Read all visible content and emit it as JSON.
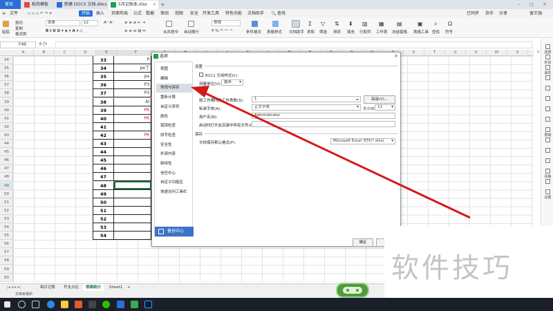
{
  "tabs": {
    "home": "首页",
    "wps": "稻壳模板",
    "docx": "新建 DOCX 文档.docx",
    "xlsx": "5月记账本.xlsx"
  },
  "menu": {
    "file": "文件",
    "start": "开始",
    "insert": "插入",
    "page_layout": "页面布局",
    "formula": "公式",
    "data": "数据",
    "review": "审阅",
    "view": "视图",
    "security": "安全",
    "dev_tools": "开发工具",
    "special": "特色功能",
    "doc_helper": "文档助手",
    "search": "查找",
    "sync": "已同步",
    "collab": "协作",
    "share": "分享",
    "user": "留王强"
  },
  "ribbon": {
    "paste": "粘贴",
    "cut": "剪切",
    "copy": "复制",
    "format_painter": "格式刷",
    "font": "宋体",
    "font_size": "12",
    "merge": "合并居中",
    "wrap": "自动换行",
    "number_format": "常规",
    "cond_format": "条件格式",
    "table_style": "表格样式",
    "doc_helper": "文档助手",
    "sum": "求和",
    "filter": "筛选",
    "sort": "排序",
    "fill": "填充",
    "row_col": "行和列",
    "worksheet": "工作表",
    "freeze": "冻结窗格",
    "table_tools": "表格工具",
    "find": "查找",
    "symbol": "符号"
  },
  "formula_bar": {
    "cell_ref": "F49"
  },
  "columns": [
    "A",
    "B",
    "C",
    "D",
    "E",
    "F",
    "G",
    "H",
    "I",
    "J",
    "K",
    "L",
    "M",
    "N",
    "O",
    "P",
    "Q",
    "R",
    "S",
    "T",
    "U",
    "V",
    "W",
    "X",
    "Y",
    "Z"
  ],
  "row_numbers": [
    "34",
    "35",
    "36",
    "37",
    "38",
    "39",
    "40",
    "41",
    "42",
    "43",
    "44",
    "45",
    "46",
    "47",
    "48",
    "49",
    "50",
    "51",
    "52",
    "53",
    "54",
    "55",
    "56",
    "57",
    "58",
    "59",
    "60",
    "61"
  ],
  "column_e_values": [
    "33",
    "34",
    "35",
    "36",
    "37",
    "38",
    "39",
    "40",
    "41",
    "42",
    "43",
    "44",
    "45",
    "46",
    "47",
    "48",
    "49",
    "50",
    "51",
    "52",
    "53",
    "54"
  ],
  "column_f_values": [
    "P",
    "pe丁",
    "pa",
    "P3",
    "P3",
    "AI",
    "PR",
    "PR",
    "",
    "PR",
    "",
    "",
    "",
    "",
    "",
    "",
    "",
    "",
    "",
    "",
    "",
    ""
  ],
  "column_f_red": [
    false,
    false,
    false,
    false,
    false,
    false,
    true,
    true,
    false,
    true,
    false,
    false,
    false,
    false,
    false,
    false,
    false,
    false,
    false,
    false,
    false,
    false
  ],
  "sheet_tabs": [
    "每日记账",
    "开支占比",
    "视频统计",
    "Sheet1"
  ],
  "active_sheet_index": 2,
  "status": "文档未保护",
  "right_panel": [
    "选择",
    "形状",
    "属性",
    "",
    "",
    "",
    "",
    "",
    "限制",
    "",
    "",
    "",
    "风格",
    "",
    "设置"
  ],
  "dialog": {
    "title": "选项",
    "nav_items": [
      "视图",
      "编辑",
      "常规与保存",
      "重新计算",
      "自定义序列",
      "颜色",
      "错误检查",
      "拼写检查",
      "安全性",
      "外部内容",
      "新特性",
      "信任中心",
      "自定义功能区",
      "快速访问工具栏"
    ],
    "selected_nav_index": 2,
    "backup_center": "备份中心",
    "section_settings": "设置",
    "r1c1_label": "R1C1 引用样式(C)",
    "unit_label": "测量单位(U):",
    "unit_value": "厘米",
    "new_sheets_label": "新工作簿内的工作表数(S):",
    "new_sheets_value": "1",
    "advanced_button": "高级(V)...",
    "std_font_label": "标准字体(A):",
    "std_font_value": "正文字体",
    "font_size_label": "大小(E):",
    "font_size_value": "11",
    "username_label": "用户名(N):",
    "username_value": "Administrator",
    "startup_label": "启动时打开此目录中所有文件(D):",
    "startup_value": "",
    "section_save": "保存",
    "save_format_label": "文档保存默认格式(F):",
    "save_format_value": "Microsoft Excel 文件(*.xlsx)",
    "ok_button": "确定",
    "cancel_button": "取"
  },
  "watermark": "软件技巧",
  "colors": {
    "accent": "#2b6fd6",
    "arrow": "#d21a1a",
    "nav_selected": "#d9dde3",
    "backup": "#3a74c6"
  }
}
